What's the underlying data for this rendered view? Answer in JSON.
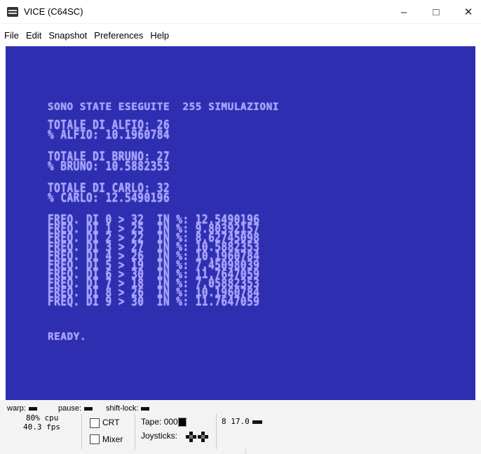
{
  "window": {
    "title": "VICE (C64SC)",
    "controls": [
      "–",
      "□",
      "✕"
    ]
  },
  "menu": [
    "File",
    "Edit",
    "Snapshot",
    "Preferences",
    "Help"
  ],
  "screen": {
    "colors": {
      "background": "#2c2cb5",
      "text": "#a8a4ff"
    },
    "lines": [
      "SONO STATE ESEGUITE  255 SIMULAZIONI",
      "TOTALE DI ALFIO: 26",
      "% ALFIO: 10.1960784",
      "TOTALE DI BRUNO: 27",
      "% BRUNO: 10.5882353",
      "TOTALE DI CARLO: 32",
      "% CARLO: 12.5490196",
      "FREQ. DI 0 > 32  IN %: 12.5490196",
      "FREQ. DI 1 > 25  IN %: 9.80392157",
      "FREQ. DI 2 > 22  IN %: 8.62745098",
      "FREQ. DI 3 > 27  IN %: 10.5882353",
      "FREQ. DI 4 > 26  IN %: 10.1960784",
      "FREQ. DI 5 > 19  IN %: 7.45098039",
      "FREQ. DI 6 > 30  IN %: 11.7647059",
      "FREQ. DI 7 > 18  IN %: 7.05882353",
      "FREQ. DI 8 > 26  IN %: 10.1960784",
      "FREQ. DI 9 > 30  IN %: 11.7647059",
      "READY."
    ]
  },
  "status": {
    "warp_label": "warp:",
    "pause_label": "pause:",
    "shiftlock_label": "shift-lock:",
    "cpu": "80% cpu",
    "fps": "40.3 fps",
    "crt_label": "CRT",
    "mixer_label": "Mixer",
    "tape_label": "Tape: 000",
    "joysticks_label": "Joysticks:",
    "drive": "8 17.0"
  }
}
